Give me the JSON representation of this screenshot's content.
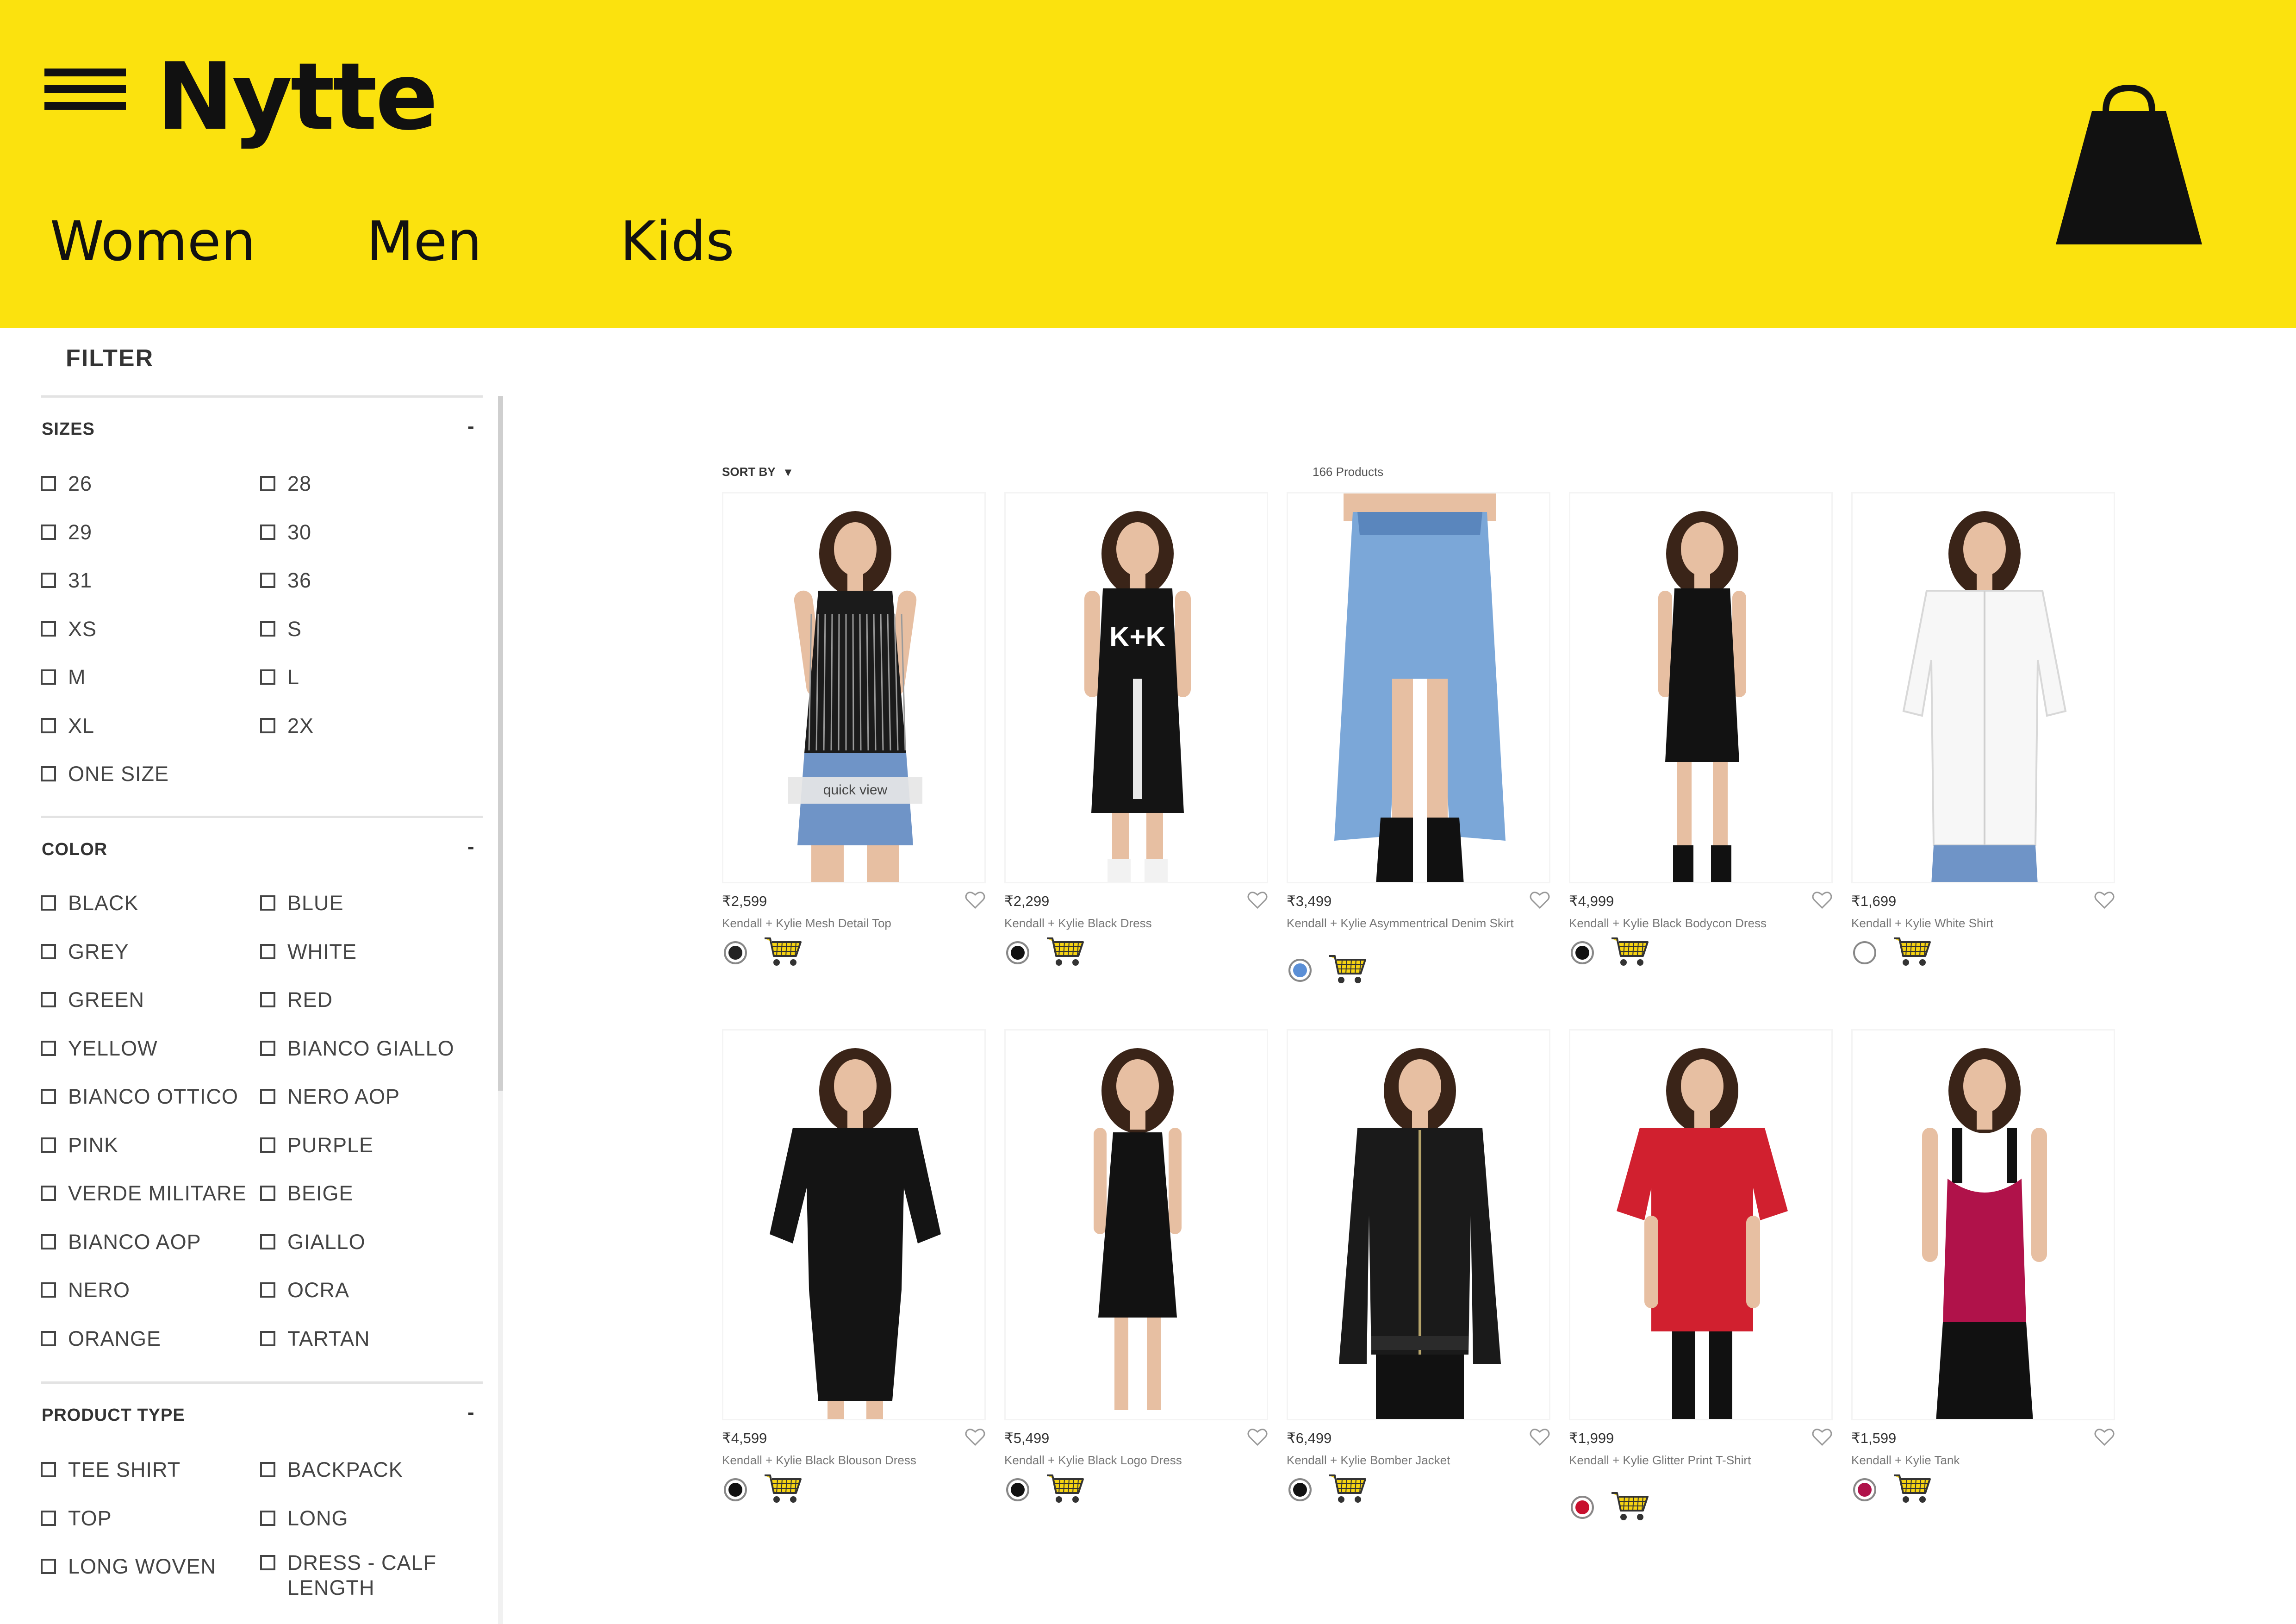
{
  "brand": {
    "name": "Nytte",
    "accent": "#fbe20e"
  },
  "nav": [
    "Women",
    "Men",
    "Kids"
  ],
  "filter": {
    "title": "FILTER",
    "sizes": {
      "title": "SIZES",
      "toggle": "-",
      "options": [
        "26",
        "28",
        "29",
        "30",
        "31",
        "36",
        "XS",
        "S",
        "M",
        "L",
        "XL",
        "2X",
        "ONE SIZE"
      ]
    },
    "color": {
      "title": "COLOR",
      "toggle": "-",
      "options": [
        "BLACK",
        "BLUE",
        "GREY",
        "WHITE",
        "GREEN",
        "RED",
        "YELLOW",
        "BIANCO GIALLO",
        "BIANCO OTTICO",
        "NERO AOP",
        "PINK",
        "PURPLE",
        "VERDE MILITARE",
        "BEIGE",
        "BIANCO AOP",
        "GIALLO",
        "NERO",
        "OCRA",
        "ORANGE",
        "TARTAN"
      ]
    },
    "product_type": {
      "title": "PRODUCT TYPE",
      "toggle": "-",
      "options": [
        "TEE SHIRT",
        "BACKPACK",
        "TOP",
        "LONG",
        "LONG WOVEN",
        "DRESS - CALF LENGTH"
      ]
    }
  },
  "listing": {
    "sort_label": "SORT BY",
    "sort_caret": "▾",
    "count_label": "166 Products",
    "quick_view": "quick view"
  },
  "products": [
    {
      "price": "₹2,599",
      "name": "Kendall + Kylie Mesh Detail Top",
      "swatch": "#222222",
      "icon": "mesh-top"
    },
    {
      "price": "₹2,299",
      "name": "Kendall + Kylie Black Dress",
      "swatch": "#111111",
      "icon": "black-dress"
    },
    {
      "price": "₹3,499",
      "name": "Kendall + Kylie Asymmentrical Denim Skirt",
      "swatch": "#5b8fd6",
      "icon": "denim-skirt"
    },
    {
      "price": "₹4,999",
      "name": "Kendall + Kylie Black Bodycon Dress",
      "swatch": "#111111",
      "icon": "bodycon-dress"
    },
    {
      "price": "₹1,699",
      "name": "Kendall + Kylie White Shirt",
      "swatch": "#ffffff",
      "icon": "white-shirt"
    },
    {
      "price": "₹4,599",
      "name": "Kendall + Kylie Black Blouson Dress",
      "swatch": "#111111",
      "icon": "blouson-dress"
    },
    {
      "price": "₹5,499",
      "name": "Kendall + Kylie Black Logo Dress",
      "swatch": "#111111",
      "icon": "logo-dress"
    },
    {
      "price": "₹6,499",
      "name": "Kendall + Kylie Bomber Jacket",
      "swatch": "#111111",
      "icon": "bomber-jacket"
    },
    {
      "price": "₹1,999",
      "name": "Kendall + Kylie Glitter Print T-Shirt",
      "swatch": "#c8102e",
      "icon": "red-tshirt"
    },
    {
      "price": "₹1,599",
      "name": "Kendall + Kylie Tank",
      "swatch": "#b0124a",
      "icon": "red-tank"
    }
  ]
}
